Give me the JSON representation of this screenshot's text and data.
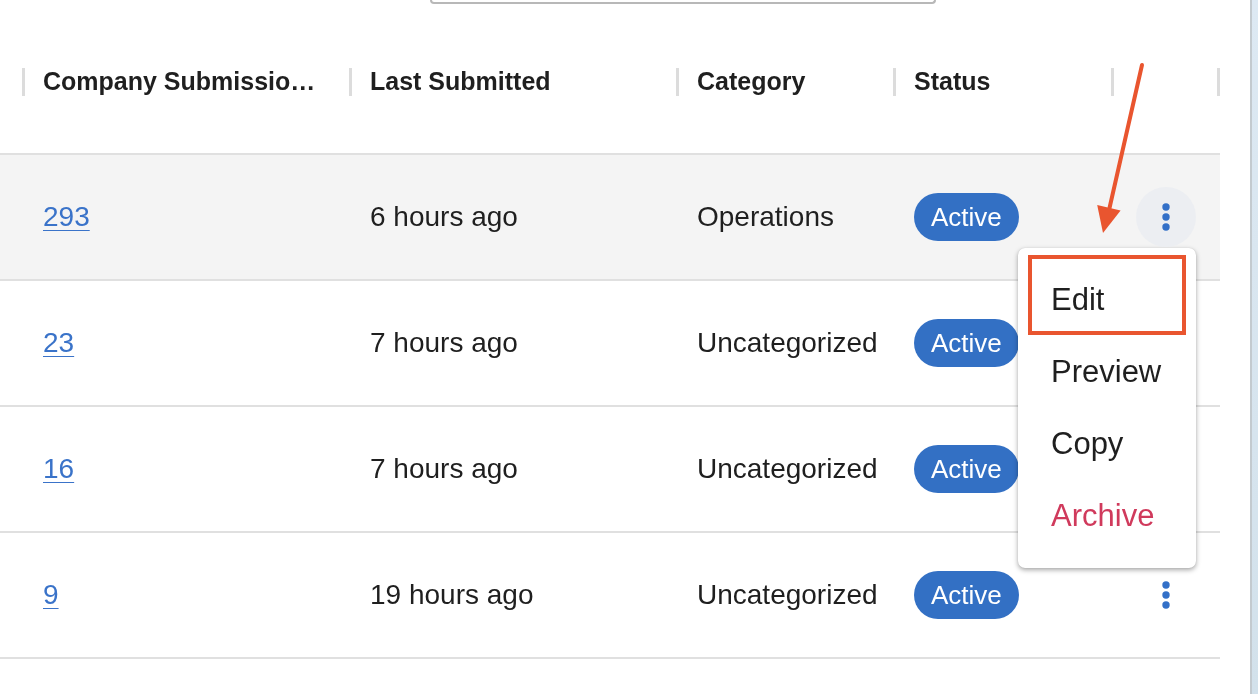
{
  "table": {
    "columns": [
      "Company Submissio…",
      "Last Submitted",
      "Category",
      "Status"
    ],
    "rows": [
      {
        "submissions": "293",
        "last_submitted": "6 hours ago",
        "category": "Operations",
        "status": "Active",
        "hovered": true,
        "menu_button": true
      },
      {
        "submissions": "23",
        "last_submitted": "7 hours ago",
        "category": "Uncategorized",
        "status": "Active",
        "hovered": false,
        "menu_button": false
      },
      {
        "submissions": "16",
        "last_submitted": "7 hours ago",
        "category": "Uncategorized",
        "status": "Active",
        "hovered": false,
        "menu_button": false
      },
      {
        "submissions": "9",
        "last_submitted": "19 hours ago",
        "category": "Uncategorized",
        "status": "Active",
        "hovered": false,
        "menu_button": true
      }
    ]
  },
  "row_menu": {
    "items": [
      {
        "label": "Edit",
        "kind": "action",
        "highlighted": true
      },
      {
        "label": "Preview",
        "kind": "action",
        "highlighted": false
      },
      {
        "label": "Copy",
        "kind": "action",
        "highlighted": false
      },
      {
        "label": "Archive",
        "kind": "danger",
        "highlighted": false
      }
    ]
  },
  "annotation_arrow": true
}
